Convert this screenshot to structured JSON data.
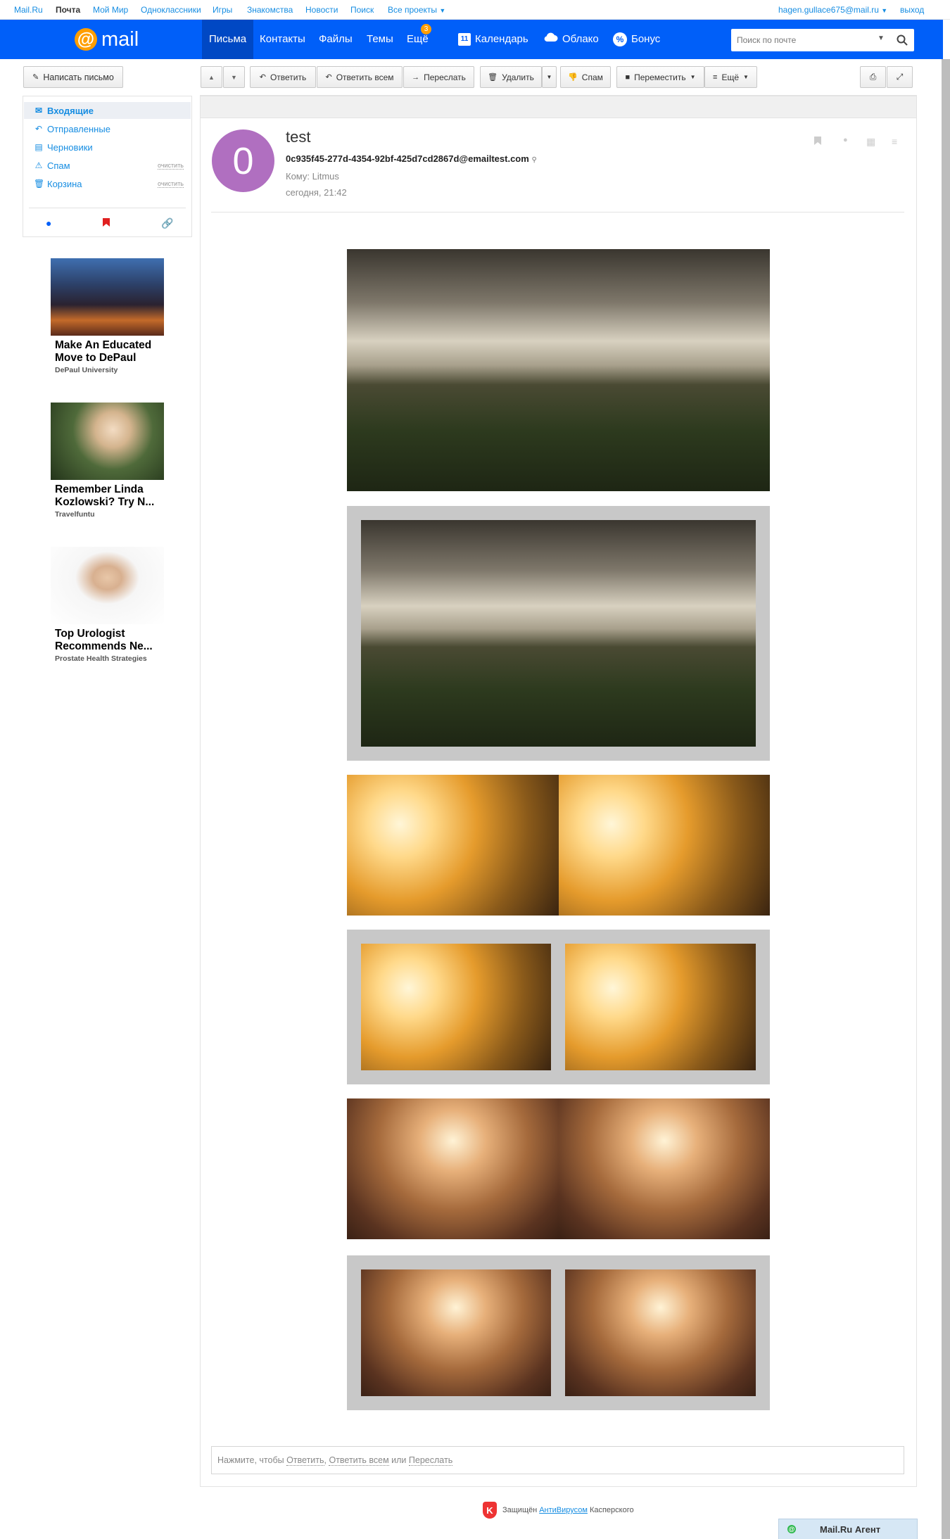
{
  "portal": {
    "links": [
      "Mail.Ru",
      "Почта",
      "Мой Мир",
      "Одноклассники",
      "Игры",
      "Знакомства",
      "Новости",
      "Поиск",
      "Все проекты"
    ],
    "user": "hagen.gullace675@mail.ru",
    "logout": "выход"
  },
  "header": {
    "logo": "mail",
    "nav": [
      "Письма",
      "Контакты",
      "Файлы",
      "Темы",
      "Ещё"
    ],
    "more_badge": "3",
    "calendar": "Календарь",
    "calendar_day": "11",
    "cloud": "Облако",
    "bonus": "Бонус",
    "search_placeholder": "Поиск по почте"
  },
  "sidebar": {
    "compose": "Написать письмо",
    "folders": [
      {
        "label": "Входящие",
        "icon": "inbox-icon"
      },
      {
        "label": "Отправленные",
        "icon": "sent-icon"
      },
      {
        "label": "Черновики",
        "icon": "drafts-icon"
      },
      {
        "label": "Спам",
        "icon": "spam-icon",
        "action": "очистить"
      },
      {
        "label": "Корзина",
        "icon": "trash-icon",
        "action": "очистить"
      }
    ],
    "ads": [
      {
        "title": "Make An Educated Move to DePaul",
        "source": "DePaul University"
      },
      {
        "title": "Remember Linda Kozlowski? Try N...",
        "source": "Travelfuntu"
      },
      {
        "title": "Top Urologist Recommends Ne...",
        "source": "Prostate Health Strategies"
      }
    ]
  },
  "toolbar": {
    "reply": "Ответить",
    "reply_all": "Ответить всем",
    "forward": "Переслать",
    "delete": "Удалить",
    "spam": "Спам",
    "move": "Переместить",
    "more": "Ещё"
  },
  "message": {
    "avatar_letter": "0",
    "subject": "test",
    "from": "0c935f45-277d-4354-92bf-425d7cd2867d@emailtest.com",
    "to": "Кому: Litmus",
    "date": "сегодня, 21:42"
  },
  "reply_box": {
    "prefix": "Нажмите, чтобы",
    "reply": "Ответить",
    "reply_all": "Ответить всем",
    "or": "или",
    "forward": "Переслать"
  },
  "footer": {
    "protected": "Защищён",
    "antivirus": "АнтиВирусом",
    "vendor": "Касперского",
    "agent": "Mail.Ru Агент"
  },
  "colors": {
    "header_bg": "#005ff9",
    "accent": "#168de2",
    "logo_at": "#ff9e00",
    "avatar": "#b06fc0"
  }
}
